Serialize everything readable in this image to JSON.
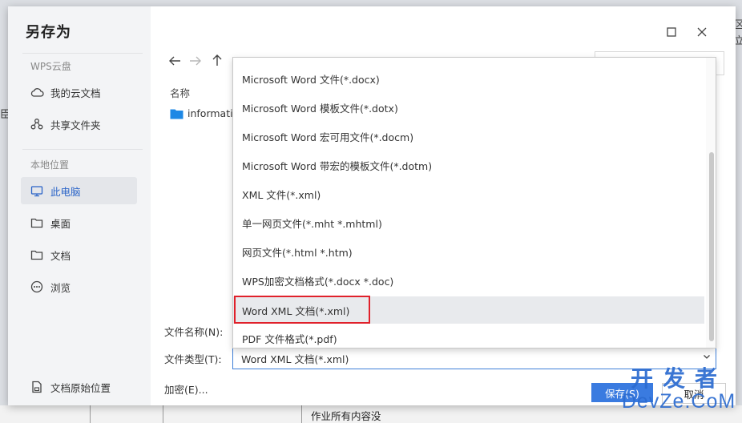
{
  "dialog": {
    "title": "另存为"
  },
  "sidebar": {
    "cloud_section": "WPS云盘",
    "cloud_items": [
      {
        "label": "我的云文档",
        "icon": "cloud-icon"
      },
      {
        "label": "共享文件夹",
        "icon": "share-icon"
      }
    ],
    "local_section": "本地位置",
    "local_items": [
      {
        "label": "此电脑",
        "icon": "computer-icon",
        "active": true
      },
      {
        "label": "桌面",
        "icon": "folder-icon"
      },
      {
        "label": "文档",
        "icon": "folder-icon"
      },
      {
        "label": "浏览",
        "icon": "more-icon"
      }
    ],
    "bottom_item": {
      "label": "文档原始位置",
      "icon": "document-icon"
    }
  },
  "nav": {
    "back_icon": "arrow-left-icon",
    "forward_icon": "arrow-right-icon",
    "up_icon": "arrow-up-icon"
  },
  "file_list": {
    "column_name": "名称",
    "items": [
      {
        "name": "informatio",
        "icon": "folder-icon"
      }
    ]
  },
  "form": {
    "filename_label": "文件名称(N):",
    "filetype_label": "文件类型(T):",
    "filetype_value": "Word XML 文档(*.xml)",
    "encrypt_label": "加密(E)..."
  },
  "buttons": {
    "save": "保存(S)",
    "cancel": "取消"
  },
  "dropdown": {
    "options": [
      "Microsoft Word 文件(*.docx)",
      "Microsoft Word 模板文件(*.dotx)",
      "Microsoft Word 宏可用文件(*.docm)",
      "Microsoft Word 带宏的模板文件(*.dotm)",
      "XML 文件(*.xml)",
      "单一网页文件(*.mht *.mhtml)",
      "网页文件(*.html *.htm)",
      "WPS加密文档格式(*.docx *.doc)",
      "Word XML 文档(*.xml)",
      "PDF 文件格式(*.pdf)"
    ],
    "selected_index": 8
  },
  "background": {
    "left_char": "臣",
    "right_chars": [
      "区",
      "立"
    ],
    "bottom_text": "作业所有内容没"
  },
  "watermark": {
    "cn": "开发者",
    "en": "DevZe.CoM"
  },
  "colors": {
    "accent": "#3a7be0",
    "highlight_box": "#e0212b",
    "sidebar_bg": "#f3f4f6"
  }
}
